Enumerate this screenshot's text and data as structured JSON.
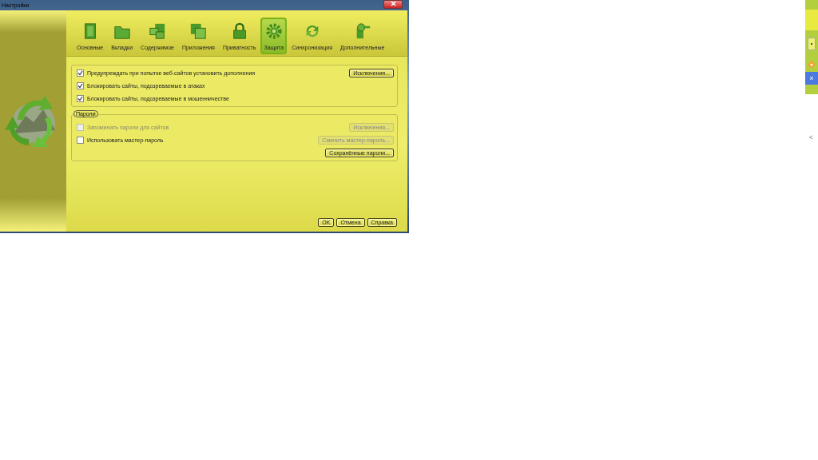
{
  "window": {
    "title": "Настройки"
  },
  "tabs": [
    {
      "label": "Основные",
      "selected": false
    },
    {
      "label": "Вкладки",
      "selected": false
    },
    {
      "label": "Содержимое",
      "selected": false
    },
    {
      "label": "Приложения",
      "selected": false
    },
    {
      "label": "Приватность",
      "selected": false
    },
    {
      "label": "Защита",
      "selected": true
    },
    {
      "label": "Синхронизация",
      "selected": false
    },
    {
      "label": "Дополнительные",
      "selected": false
    }
  ],
  "general_group": {
    "rows": [
      {
        "label": "Предупреждать при попытке веб-сайтов установить дополнения",
        "checked": true,
        "disabled": false,
        "button": {
          "label": "Исключения...",
          "disabled": false
        }
      },
      {
        "label": "Блокировать сайты, подозреваемые в атаках",
        "checked": true,
        "disabled": false
      },
      {
        "label": "Блокировать сайты, подозреваемые в мошенничестве",
        "checked": true,
        "disabled": false
      }
    ]
  },
  "passwords_group": {
    "title": "Пароли",
    "rows": [
      {
        "label": "Запоминать пароли для сайтов",
        "checked": false,
        "disabled": true,
        "button": {
          "label": "Исключения...",
          "disabled": true
        }
      },
      {
        "label": "Использовать мастер-пароль",
        "checked": false,
        "disabled": false,
        "button": {
          "label": "Сменить мастер-пароль...",
          "disabled": true
        }
      }
    ],
    "extra_button": {
      "label": "Сохранённые пароли...",
      "disabled": false
    }
  },
  "dialog_buttons": [
    "OK",
    "Отмена",
    "Справка"
  ],
  "side_strip": {
    "close_glyph": "×",
    "collapse_glyph": "<"
  }
}
